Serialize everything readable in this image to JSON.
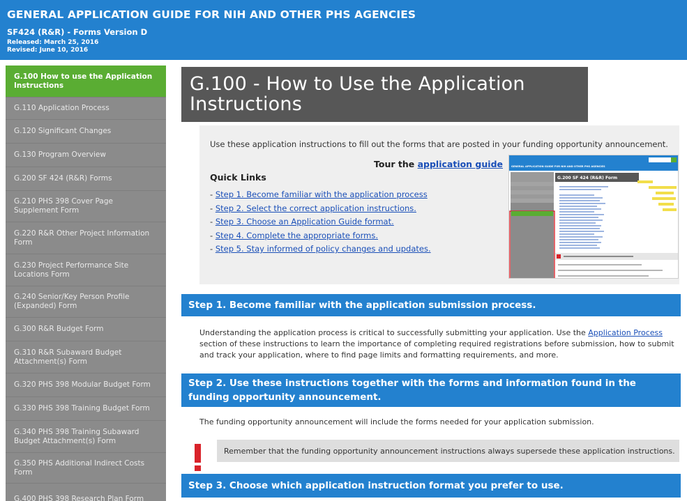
{
  "header": {
    "title": "GENERAL APPLICATION GUIDE FOR NIH AND OTHER PHS AGENCIES",
    "subtitle": "SF424 (R&R) - Forms Version D",
    "released": "Released: March 25, 2016",
    "revised": "Revised: June 10, 2016"
  },
  "sidebar": {
    "items": [
      {
        "label": "G.100 How to use the Application Instructions",
        "active": true
      },
      {
        "label": "G.110 Application Process"
      },
      {
        "label": "G.120 Significant Changes"
      },
      {
        "label": "G.130 Program Overview"
      },
      {
        "label": "G.200 SF 424 (R&R) Forms"
      },
      {
        "label": "G.210 PHS 398 Cover Page Supplement Form"
      },
      {
        "label": "G.220 R&R Other Project Information Form"
      },
      {
        "label": "G.230 Project Performance Site Locations Form"
      },
      {
        "label": "G.240 Senior/Key Person Profile (Expanded) Form"
      },
      {
        "label": "G.300 R&R Budget Form"
      },
      {
        "label": "G.310 R&R Subaward Budget Attachment(s) Form"
      },
      {
        "label": "G.320 PHS 398 Modular Budget Form"
      },
      {
        "label": "G.330 PHS 398 Training Budget Form"
      },
      {
        "label": "G.340 PHS 398 Training Subaward Budget Attachment(s) Form"
      },
      {
        "label": "G.350 PHS Additional Indirect Costs Form"
      },
      {
        "label": "G.400 PHS 398 Research Plan Form"
      }
    ]
  },
  "main": {
    "page_title": "G.100 - How to Use the Application Instructions",
    "intro": "Use these application instructions to fill out the forms that are posted in your funding opportunity announcement.",
    "tour_prefix": "Tour the",
    "tour_link": "application guide",
    "quick_links_title": "Quick Links",
    "quick_links": [
      "Step 1. Become familiar with the application process",
      "Step 2. Select the correct application instructions.",
      "Step 3. Choose an Application Guide format.",
      "Step 4. Complete the appropriate forms.",
      "Step 5. Stay informed of policy changes and updates."
    ],
    "step1": {
      "heading": "Step 1. Become familiar with the application submission process.",
      "text_before_link": "Understanding the application process is critical to successfully submitting your application. Use the ",
      "link": "Application Process",
      "text_after_link": " section of these instructions to learn the importance of completing required registrations before submission, how to submit and track your application, where to find page limits and formatting requirements, and more."
    },
    "step2": {
      "heading": "Step 2. Use these instructions together with the forms and information found in the funding opportunity announcement.",
      "text": "The funding opportunity announcement will include the forms needed for your application submission.",
      "alert": "Remember that the funding opportunity announcement instructions always supersede these application instructions."
    },
    "step3": {
      "heading": "Step 3. Choose which application instruction format you prefer to use."
    }
  },
  "thumbnail": {
    "header_title": "GENERAL APPLICATION GUIDE FOR NIH AND OTHER PHS AGENCIES",
    "page_title": "G.200 SF 424 (R&R) Form"
  },
  "colors": {
    "header_blue": "#2381cf",
    "sidebar_gray": "#8b8b8b",
    "active_green": "#5aad33",
    "title_box": "#575757",
    "alert_red": "#d9232a",
    "link_blue": "#1a4fb8"
  }
}
